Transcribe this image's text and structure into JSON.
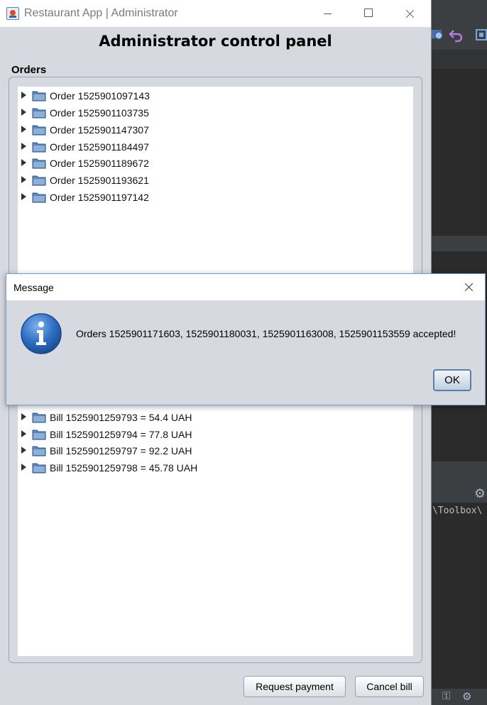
{
  "window": {
    "title": "Restaurant App | Administrator",
    "heading": "Administrator control panel"
  },
  "orders": {
    "label": "Orders",
    "items": [
      "Order 1525901097143",
      "Order 1525901103735",
      "Order 1525901147307",
      "Order 1525901184497",
      "Order 1525901189672",
      "Order 1525901193621",
      "Order 1525901197142"
    ]
  },
  "bills": {
    "items": [
      "Bill 1525901259793 = 54.4 UAH",
      "Bill 1525901259794 = 77.8 UAH",
      "Bill 1525901259797 = 92.2 UAH",
      "Bill 1525901259798 = 45.78 UAH"
    ]
  },
  "buttons": {
    "request_payment": "Request payment",
    "cancel_bill": "Cancel bill"
  },
  "dialog": {
    "title": "Message",
    "message": "Orders 1525901171603, 1525901180031, 1525901163008, 1525901153559 accepted!",
    "ok": "OK",
    "icon": "info-icon"
  },
  "ide_background": {
    "path_text": "\\Toolbox\\"
  }
}
